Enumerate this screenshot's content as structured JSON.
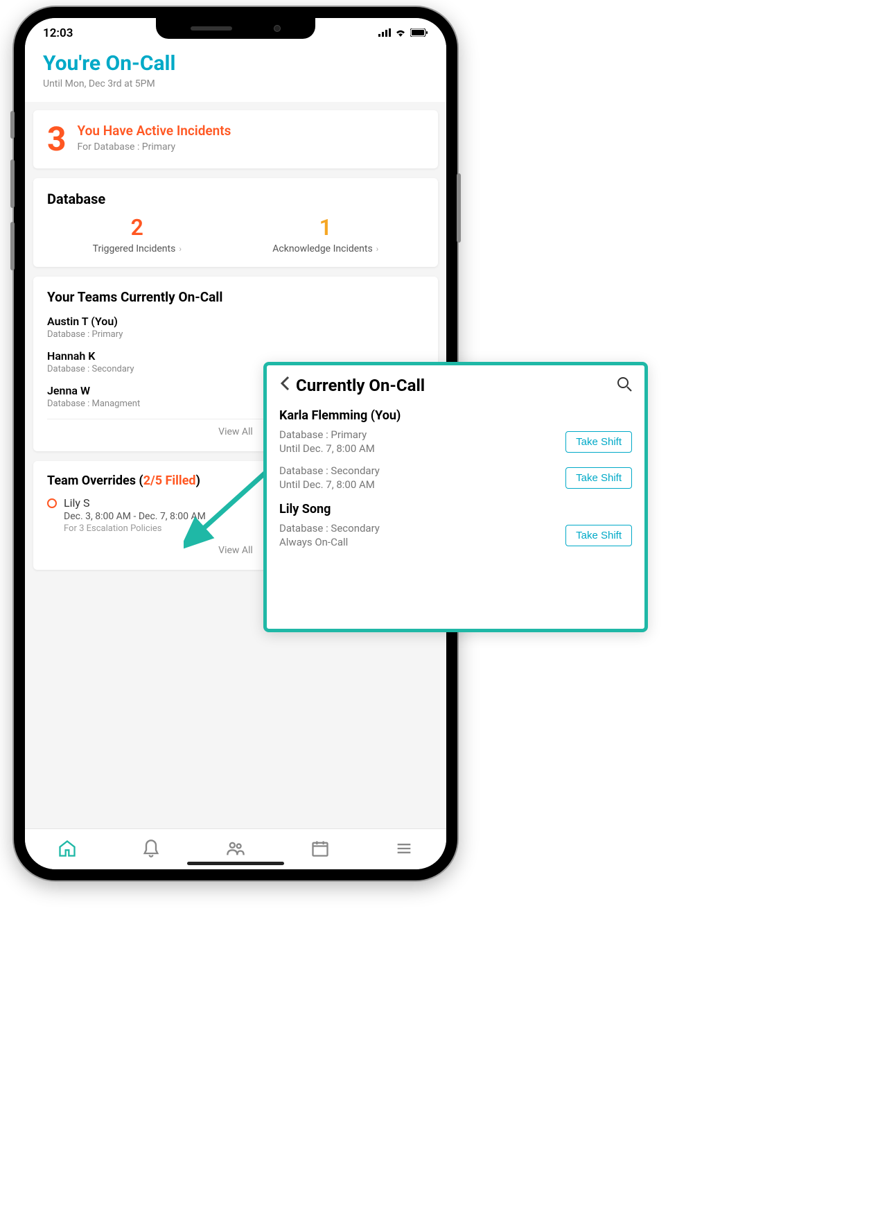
{
  "status": {
    "time": "12:03"
  },
  "header": {
    "title": "You're On-Call",
    "subtitle": "Until Mon, Dec 3rd at 5PM"
  },
  "incidents": {
    "count": "3",
    "title": "You Have Active Incidents",
    "subtitle": "For Database : Primary"
  },
  "database": {
    "title": "Database",
    "triggered": {
      "count": "2",
      "label": "Triggered Incidents"
    },
    "ack": {
      "count": "1",
      "label": "Acknowledge Incidents"
    }
  },
  "teams": {
    "title": "Your Teams Currently On-Call",
    "members": [
      {
        "name": "Austin T (You)",
        "role": "Database : Primary"
      },
      {
        "name": "Hannah K",
        "role": "Database : Secondary"
      },
      {
        "name": "Jenna W",
        "role": "Database : Managment"
      }
    ],
    "view_all": "View All"
  },
  "overrides": {
    "title_prefix": "Team Overrides (",
    "filled": "2/5 Filled",
    "title_suffix": ")",
    "entry": {
      "name": "Lily S",
      "time": "Dec. 3, 8:00 AM - Dec. 7, 8:00 AM",
      "policies": "For 3 Escalation Policies"
    },
    "view_all": "View All"
  },
  "overlay": {
    "title": "Currently On-Call",
    "take_shift": "Take Shift",
    "people": [
      {
        "name": "Karla Flemming (You)",
        "shifts": [
          {
            "db": "Database : Primary",
            "until": "Until Dec. 7, 8:00 AM"
          },
          {
            "db": "Database : Secondary",
            "until": "Until Dec. 7, 8:00 AM"
          }
        ]
      },
      {
        "name": "Lily Song",
        "shifts": [
          {
            "db": "Database : Secondary",
            "until": "Always On-Call"
          }
        ]
      }
    ]
  }
}
